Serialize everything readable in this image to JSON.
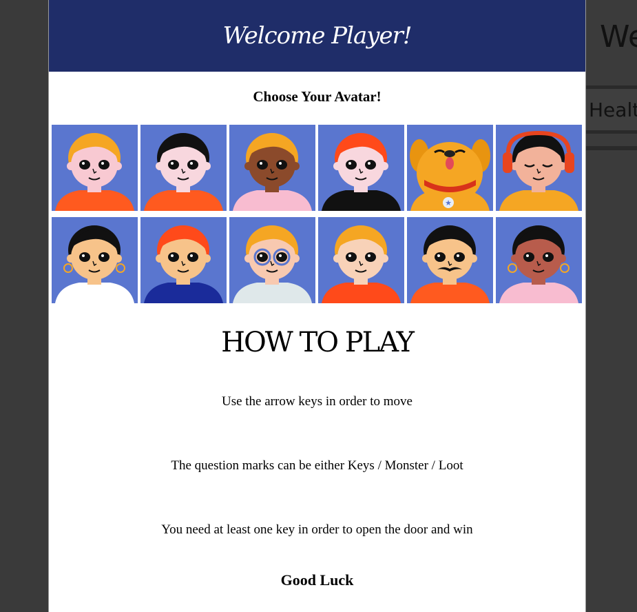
{
  "background": {
    "title": "We",
    "health_label": "Healt"
  },
  "modal": {
    "title": "Welcome Player!",
    "choose_label": "Choose Your Avatar!",
    "avatars": [
      {
        "id": "avatar-1",
        "skin": "#f8c9d2",
        "hair": "#f5a623",
        "shirt": "#ff5a1f"
      },
      {
        "id": "avatar-2",
        "skin": "#f8d7de",
        "hair": "#111111",
        "shirt": "#ff5a1f"
      },
      {
        "id": "avatar-3",
        "skin": "#8b4a2b",
        "hair": "#f5a623",
        "shirt": "#f8bcd0"
      },
      {
        "id": "avatar-4",
        "skin": "#f8d7de",
        "hair": "#ff4a1a",
        "shirt": "#111111"
      },
      {
        "id": "avatar-5",
        "skin": "#f5a623",
        "hair": "#f5a623",
        "shirt": "#f5a623"
      },
      {
        "id": "avatar-6",
        "skin": "#f2b29a",
        "hair": "#111111",
        "shirt": "#f5a623"
      },
      {
        "id": "avatar-7",
        "skin": "#f7c38a",
        "hair": "#111111",
        "shirt": "#ffffff"
      },
      {
        "id": "avatar-8",
        "skin": "#f7c38a",
        "hair": "#ff4a1a",
        "shirt": "#1a2b9a"
      },
      {
        "id": "avatar-9",
        "skin": "#f8c9b0",
        "hair": "#f5a623",
        "shirt": "#dfe8ea"
      },
      {
        "id": "avatar-10",
        "skin": "#f8d2b8",
        "hair": "#f5a623",
        "shirt": "#ff4a1a"
      },
      {
        "id": "avatar-11",
        "skin": "#f7c38a",
        "hair": "#111111",
        "shirt": "#ff5a1f"
      },
      {
        "id": "avatar-12",
        "skin": "#b85c4c",
        "hair": "#111111",
        "shirt": "#f8bcd0"
      }
    ],
    "how_to_play_title": "HOW TO PLAY",
    "rules": [
      "Use the arrow keys in order to move",
      "The question marks can be either Keys / Monster / Loot",
      "You need at least one key in order to open the door and win"
    ],
    "good_luck": "Good Luck"
  },
  "colors": {
    "header_bg": "#1f2d69",
    "avatar_bg": "#5a76cf"
  }
}
